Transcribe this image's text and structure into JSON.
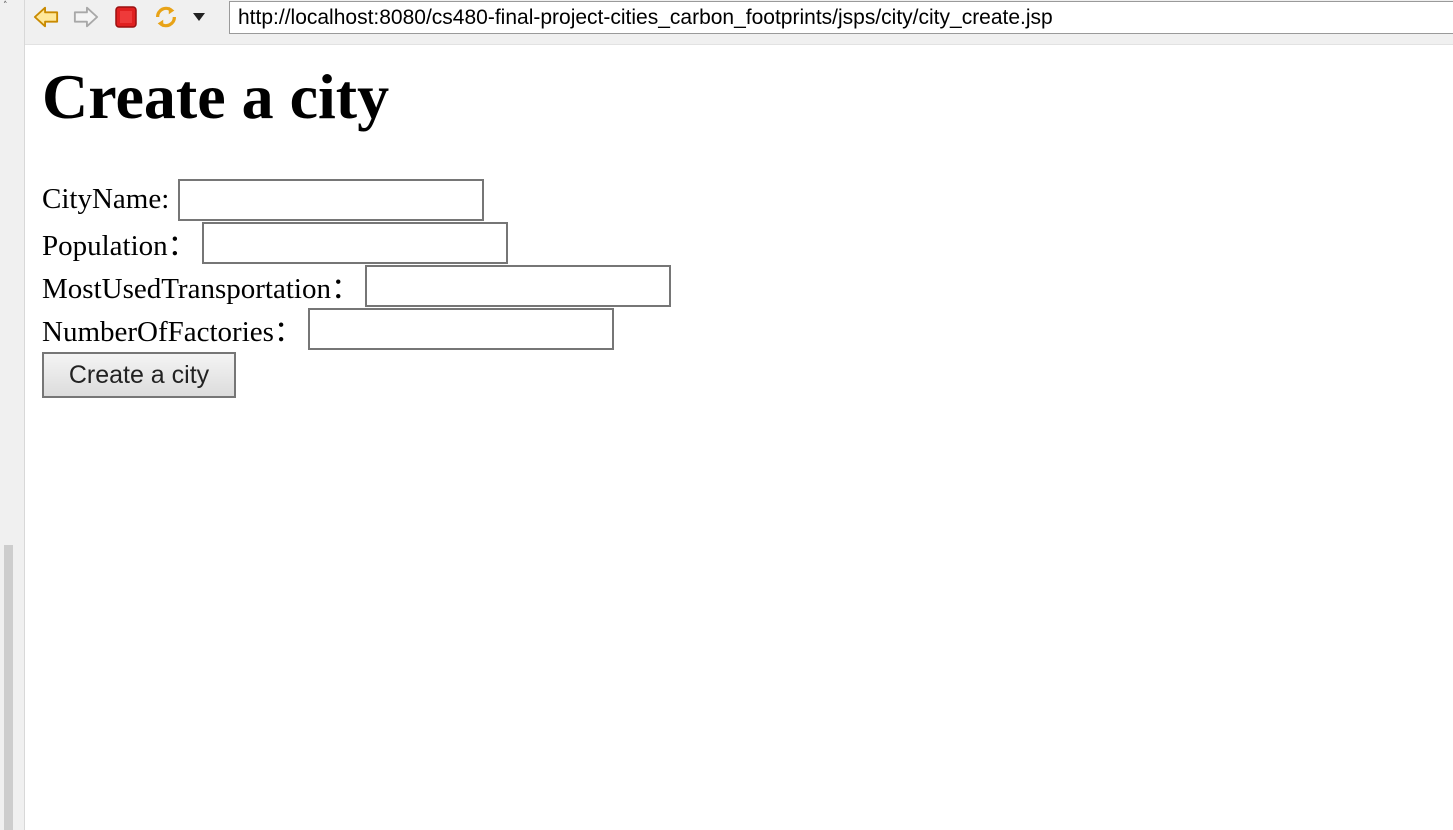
{
  "browser": {
    "url": "http://localhost:8080/cs480-final-project-cities_carbon_footprints/jsps/city/city_create.jsp",
    "icons": [
      "back-arrow-icon",
      "forward-arrow-icon",
      "stop-icon",
      "refresh-icon",
      "dropdown-arrow-icon"
    ]
  },
  "page": {
    "title": "Create a city",
    "form": {
      "fields": [
        {
          "label": "CityName: ",
          "value": ""
        },
        {
          "label": "Population：",
          "value": ""
        },
        {
          "label": "MostUsedTransportation：",
          "value": ""
        },
        {
          "label": "NumberOfFactories：",
          "value": ""
        }
      ],
      "submit_label": "Create a city"
    }
  },
  "colors": {
    "toolbar_bg": "#f0f0f0",
    "input_border": "#767676",
    "stop_red": "#e02020",
    "arrow_orange": "#e8a317"
  }
}
